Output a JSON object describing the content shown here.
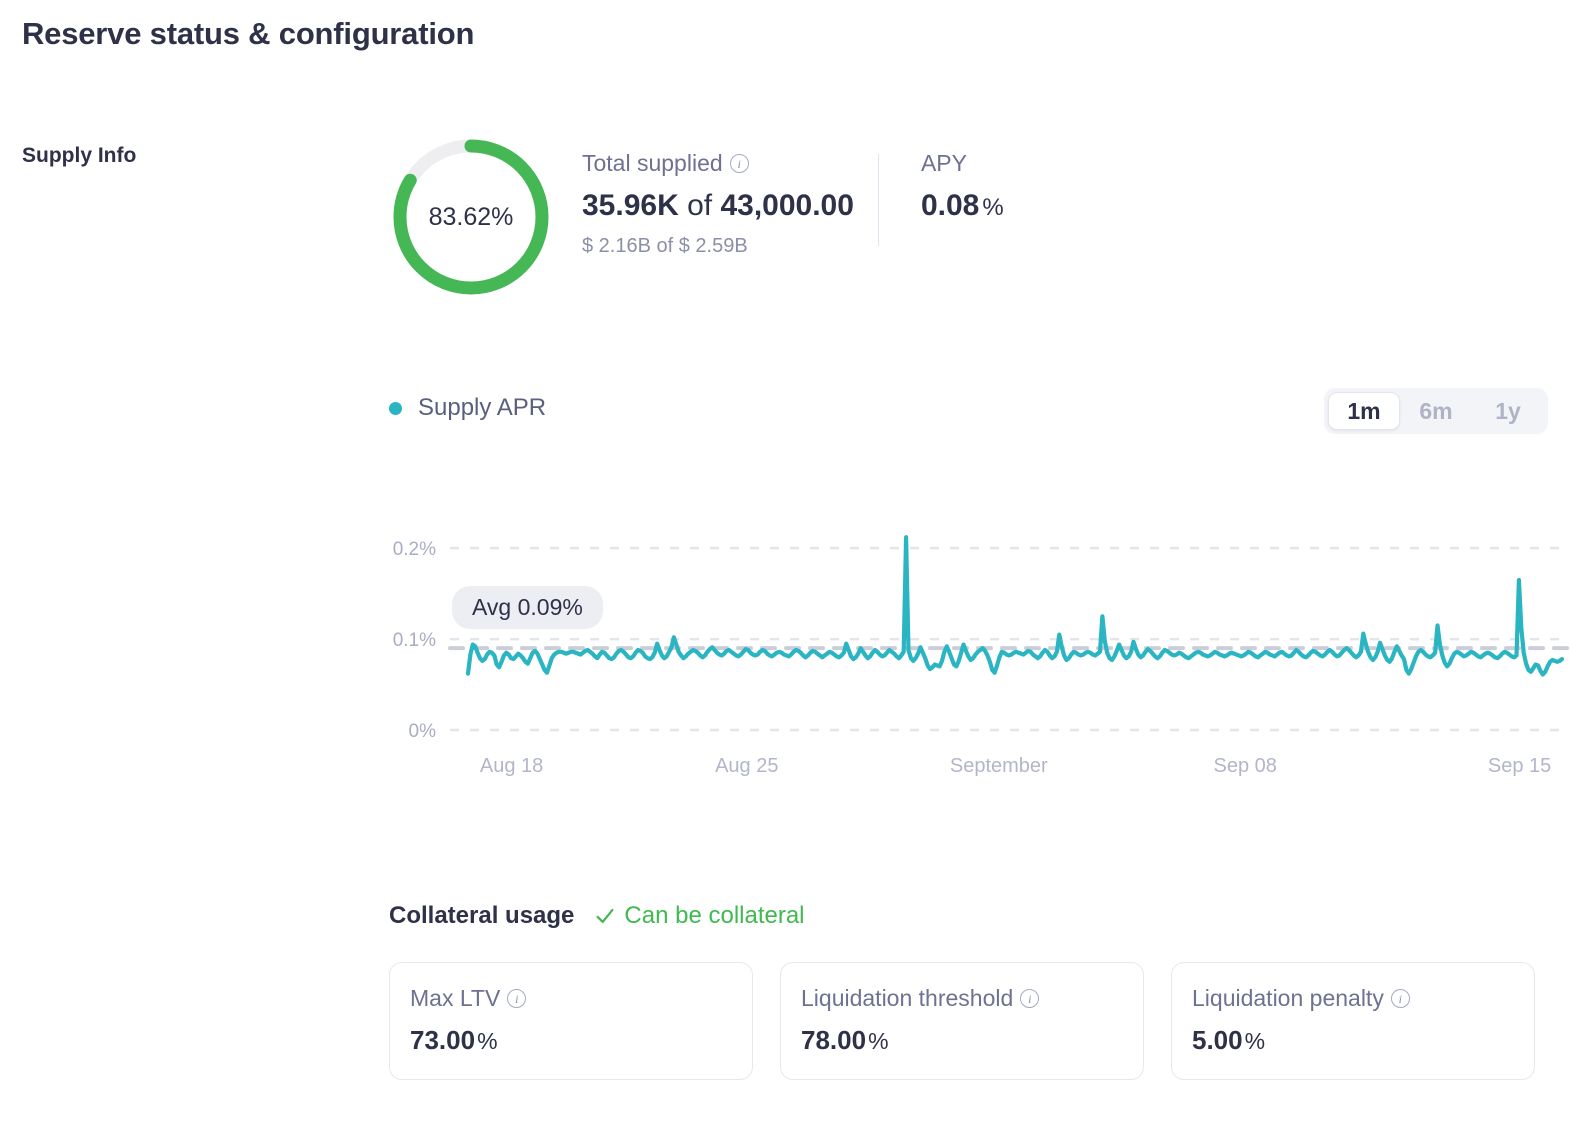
{
  "page": {
    "title": "Reserve status & configuration",
    "section_label": "Supply Info"
  },
  "colors": {
    "accent_green": "#46b755",
    "track_grey": "#eeeef0",
    "line_teal": "#2bb5c2",
    "text_dark": "#2e3148",
    "text_muted": "#6e7191"
  },
  "supply": {
    "utilization_label": "83.62%",
    "utilization_pct": 83.62,
    "total_supplied": {
      "label": "Total supplied",
      "info_icon": "info-icon",
      "amount": "35.96K",
      "of_word": "of",
      "cap": "43,000.00",
      "usd_sub": "$ 2.16B of $ 2.59B"
    },
    "apy": {
      "label": "APY",
      "value": "0.08",
      "unit": "%"
    }
  },
  "chart_header": {
    "legend_label": "Supply APR",
    "legend_dot": "legend-dot",
    "ranges": [
      {
        "label": "1m",
        "active": true
      },
      {
        "label": "6m",
        "active": false
      },
      {
        "label": "1y",
        "active": false
      }
    ]
  },
  "avg_badge": "Avg 0.09%",
  "chart_data": {
    "type": "line",
    "title": "Supply APR",
    "xlabel": "",
    "ylabel": "",
    "ylim": [
      0,
      0.22
    ],
    "grid": true,
    "grid_style": "dashed-horizontal",
    "legend_position": "top-left",
    "y_ticks": [
      0,
      0.1,
      0.2
    ],
    "y_tick_labels": [
      "0%",
      "0.1%",
      "0.2%"
    ],
    "x_tick_positions": [
      0.055,
      0.265,
      0.49,
      0.71,
      0.955
    ],
    "x_tick_labels": [
      "Aug 18",
      "Aug 25",
      "September",
      "Sep 08",
      "Sep 15"
    ],
    "average": 0.09,
    "average_label": "Avg 0.09%",
    "series": [
      {
        "name": "Supply APR",
        "color": "#2bb5c2",
        "values": [
          0.062,
          0.083,
          0.094,
          0.092,
          0.085,
          0.079,
          0.076,
          0.078,
          0.083,
          0.086,
          0.085,
          0.082,
          0.072,
          0.069,
          0.075,
          0.082,
          0.085,
          0.083,
          0.079,
          0.078,
          0.081,
          0.084,
          0.082,
          0.079,
          0.075,
          0.073,
          0.079,
          0.085,
          0.087,
          0.084,
          0.078,
          0.072,
          0.066,
          0.063,
          0.071,
          0.079,
          0.083,
          0.085,
          0.086,
          0.086,
          0.085,
          0.084,
          0.085,
          0.086,
          0.086,
          0.085,
          0.084,
          0.083,
          0.085,
          0.087,
          0.088,
          0.086,
          0.084,
          0.081,
          0.079,
          0.083,
          0.086,
          0.085,
          0.082,
          0.079,
          0.078,
          0.08,
          0.084,
          0.087,
          0.088,
          0.086,
          0.083,
          0.08,
          0.079,
          0.081,
          0.085,
          0.088,
          0.087,
          0.085,
          0.081,
          0.079,
          0.078,
          0.08,
          0.085,
          0.095,
          0.088,
          0.082,
          0.079,
          0.081,
          0.086,
          0.091,
          0.102,
          0.094,
          0.086,
          0.082,
          0.079,
          0.081,
          0.084,
          0.086,
          0.088,
          0.087,
          0.085,
          0.082,
          0.08,
          0.082,
          0.086,
          0.089,
          0.091,
          0.088,
          0.085,
          0.083,
          0.082,
          0.084,
          0.087,
          0.088,
          0.086,
          0.084,
          0.082,
          0.081,
          0.083,
          0.086,
          0.089,
          0.088,
          0.085,
          0.083,
          0.082,
          0.083,
          0.086,
          0.088,
          0.087,
          0.084,
          0.082,
          0.081,
          0.083,
          0.085,
          0.086,
          0.085,
          0.083,
          0.082,
          0.081,
          0.083,
          0.086,
          0.088,
          0.087,
          0.085,
          0.082,
          0.08,
          0.082,
          0.085,
          0.087,
          0.086,
          0.084,
          0.082,
          0.08,
          0.082,
          0.084,
          0.086,
          0.085,
          0.083,
          0.081,
          0.08,
          0.082,
          0.085,
          0.095,
          0.088,
          0.081,
          0.078,
          0.08,
          0.084,
          0.09,
          0.086,
          0.082,
          0.079,
          0.081,
          0.085,
          0.088,
          0.086,
          0.083,
          0.081,
          0.082,
          0.085,
          0.088,
          0.086,
          0.084,
          0.081,
          0.079,
          0.082,
          0.086,
          0.212,
          0.088,
          0.079,
          0.076,
          0.079,
          0.084,
          0.091,
          0.085,
          0.079,
          0.071,
          0.067,
          0.069,
          0.072,
          0.071,
          0.07,
          0.076,
          0.086,
          0.092,
          0.086,
          0.079,
          0.072,
          0.07,
          0.076,
          0.085,
          0.094,
          0.087,
          0.081,
          0.077,
          0.079,
          0.083,
          0.086,
          0.088,
          0.09,
          0.087,
          0.082,
          0.075,
          0.066,
          0.063,
          0.071,
          0.08,
          0.086,
          0.085,
          0.083,
          0.082,
          0.083,
          0.085,
          0.086,
          0.085,
          0.084,
          0.083,
          0.085,
          0.087,
          0.086,
          0.083,
          0.081,
          0.079,
          0.081,
          0.085,
          0.088,
          0.086,
          0.082,
          0.079,
          0.081,
          0.086,
          0.105,
          0.092,
          0.082,
          0.077,
          0.079,
          0.083,
          0.086,
          0.085,
          0.083,
          0.082,
          0.083,
          0.085,
          0.086,
          0.085,
          0.083,
          0.082,
          0.084,
          0.086,
          0.125,
          0.098,
          0.085,
          0.079,
          0.077,
          0.081,
          0.087,
          0.094,
          0.088,
          0.082,
          0.079,
          0.081,
          0.086,
          0.097,
          0.089,
          0.083,
          0.08,
          0.082,
          0.086,
          0.089,
          0.087,
          0.084,
          0.081,
          0.079,
          0.081,
          0.085,
          0.088,
          0.087,
          0.085,
          0.083,
          0.082,
          0.083,
          0.085,
          0.084,
          0.082,
          0.08,
          0.079,
          0.081,
          0.083,
          0.085,
          0.086,
          0.085,
          0.083,
          0.082,
          0.081,
          0.082,
          0.084,
          0.086,
          0.085,
          0.083,
          0.082,
          0.081,
          0.082,
          0.084,
          0.085,
          0.084,
          0.083,
          0.082,
          0.081,
          0.082,
          0.084,
          0.086,
          0.085,
          0.083,
          0.081,
          0.08,
          0.082,
          0.084,
          0.086,
          0.085,
          0.083,
          0.082,
          0.081,
          0.083,
          0.085,
          0.086,
          0.084,
          0.082,
          0.081,
          0.082,
          0.085,
          0.088,
          0.086,
          0.083,
          0.081,
          0.08,
          0.082,
          0.085,
          0.087,
          0.086,
          0.084,
          0.082,
          0.081,
          0.083,
          0.086,
          0.088,
          0.086,
          0.083,
          0.081,
          0.082,
          0.085,
          0.088,
          0.09,
          0.088,
          0.085,
          0.082,
          0.08,
          0.082,
          0.086,
          0.106,
          0.095,
          0.086,
          0.08,
          0.077,
          0.08,
          0.086,
          0.096,
          0.089,
          0.082,
          0.077,
          0.075,
          0.079,
          0.086,
          0.092,
          0.087,
          0.082,
          0.078,
          0.066,
          0.062,
          0.067,
          0.074,
          0.081,
          0.086,
          0.088,
          0.086,
          0.083,
          0.081,
          0.08,
          0.082,
          0.085,
          0.115,
          0.094,
          0.082,
          0.074,
          0.07,
          0.073,
          0.079,
          0.084,
          0.086,
          0.085,
          0.083,
          0.081,
          0.082,
          0.084,
          0.086,
          0.085,
          0.083,
          0.081,
          0.08,
          0.082,
          0.084,
          0.085,
          0.084,
          0.082,
          0.08,
          0.079,
          0.081,
          0.084,
          0.086,
          0.085,
          0.083,
          0.081,
          0.08,
          0.082,
          0.165,
          0.112,
          0.085,
          0.073,
          0.066,
          0.064,
          0.068,
          0.072,
          0.071,
          0.065,
          0.061,
          0.064,
          0.07,
          0.075,
          0.077,
          0.076,
          0.075,
          0.076,
          0.078
        ]
      }
    ]
  },
  "collateral": {
    "title": "Collateral usage",
    "status_text": "Can be collateral",
    "status_icon": "check-icon",
    "cards": [
      {
        "label": "Max LTV",
        "value": "73.00",
        "unit": "%",
        "info_icon": "info-icon"
      },
      {
        "label": "Liquidation threshold",
        "value": "78.00",
        "unit": "%",
        "info_icon": "info-icon"
      },
      {
        "label": "Liquidation penalty",
        "value": "5.00",
        "unit": "%",
        "info_icon": "info-icon"
      }
    ]
  }
}
